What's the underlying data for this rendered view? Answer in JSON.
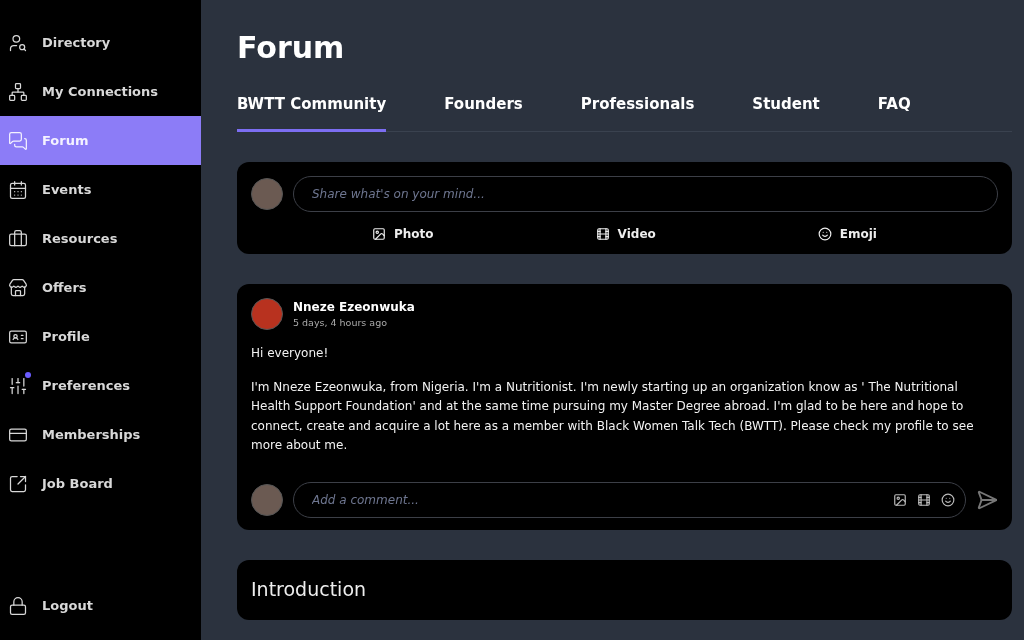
{
  "sidebar": {
    "items": [
      {
        "label": "Directory",
        "selected": false,
        "dot": false
      },
      {
        "label": "My Connections",
        "selected": false,
        "dot": false
      },
      {
        "label": "Forum",
        "selected": true,
        "dot": false
      },
      {
        "label": "Events",
        "selected": false,
        "dot": false
      },
      {
        "label": "Resources",
        "selected": false,
        "dot": false
      },
      {
        "label": "Offers",
        "selected": false,
        "dot": false
      },
      {
        "label": "Profile",
        "selected": false,
        "dot": false
      },
      {
        "label": "Preferences",
        "selected": false,
        "dot": true
      },
      {
        "label": "Memberships",
        "selected": false,
        "dot": false
      },
      {
        "label": "Job Board",
        "selected": false,
        "dot": false
      }
    ],
    "logout": "Logout"
  },
  "page": {
    "title": "Forum"
  },
  "tabs": [
    {
      "label": "BWTT Community",
      "selected": true
    },
    {
      "label": "Founders",
      "selected": false
    },
    {
      "label": "Professionals",
      "selected": false
    },
    {
      "label": "Student",
      "selected": false
    },
    {
      "label": "FAQ",
      "selected": false
    }
  ],
  "composer": {
    "placeholder": "Share what's on your mind...",
    "actions": [
      "Photo",
      "Video",
      "Emoji"
    ]
  },
  "post": {
    "author": "Nneze Ezeonwuka",
    "time": "5 days, 4 hours ago",
    "paragraphs": [
      "Hi everyone!",
      "I'm Nneze Ezeonwuka, from Nigeria. I'm a Nutritionist. I'm newly starting up an organization know as ' The Nutritional Health Support Foundation' and at the same time pursuing my Master Degree abroad. I'm glad to be here and hope to connect, create and acquire a lot here as a member with Black Women Talk Tech (BWTT). Please check my profile to see more about me."
    ],
    "comment_placeholder": "Add a comment..."
  },
  "next_card": {
    "title": "Introduction"
  }
}
